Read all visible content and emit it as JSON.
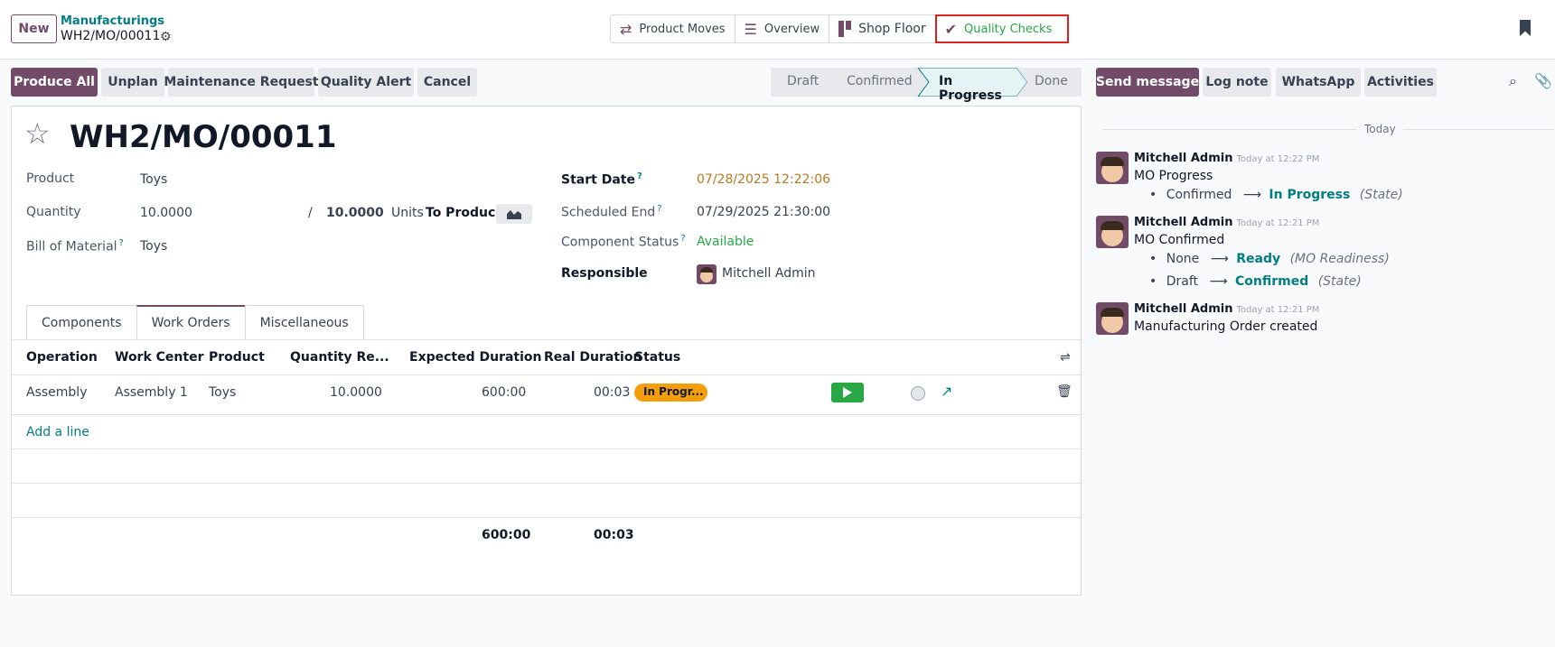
{
  "header": {
    "new_label": "New",
    "breadcrumb_parent": "Manufacturings",
    "record_name": "WH2/MO/00011"
  },
  "smart_buttons": {
    "product_moves": "Product Moves",
    "overview": "Overview",
    "shop_floor": "Shop Floor",
    "quality_checks": "Quality Checks"
  },
  "actions": {
    "produce_all": "Produce All",
    "unplan": "Unplan",
    "maintenance_request": "Maintenance Request",
    "quality_alert": "Quality Alert",
    "cancel": "Cancel"
  },
  "stages": [
    "Draft",
    "Confirmed",
    "In Progress",
    "Done"
  ],
  "form": {
    "title": "WH2/MO/00011",
    "product_label": "Product",
    "product_value": "Toys",
    "quantity_label": "Quantity",
    "quantity_value": "10.0000",
    "quantity_slash": "/",
    "quantity_target": "10.0000",
    "units_label": "Units",
    "to_produce_label": "To Produce",
    "bom_label": "Bill of Material",
    "bom_value": "Toys",
    "start_date_label": "Start Date",
    "start_date_value": "07/28/2025 12:22:06",
    "scheduled_end_label": "Scheduled End",
    "scheduled_end_value": "07/29/2025 21:30:00",
    "component_status_label": "Component Status",
    "component_status_value": "Available",
    "responsible_label": "Responsible",
    "responsible_value": "Mitchell Admin",
    "help_mark": "?"
  },
  "tabs": [
    "Components",
    "Work Orders",
    "Miscellaneous"
  ],
  "table": {
    "columns": [
      "Operation",
      "Work Center",
      "Product",
      "Quantity Re...",
      "Expected Duration",
      "Real Duration",
      "Status"
    ],
    "row": {
      "operation": "Assembly",
      "work_center": "Assembly 1",
      "product": "Toys",
      "quantity": "10.0000",
      "expected": "600:00",
      "real": "00:03",
      "status": "In Progr..."
    },
    "add_line": "Add a line",
    "total_expected": "600:00",
    "total_real": "00:03"
  },
  "chatter": {
    "send_message": "Send message",
    "log_note": "Log note",
    "whatsapp": "WhatsApp",
    "activities": "Activities",
    "day_label": "Today",
    "messages": [
      {
        "author": "Mitchell Admin",
        "time": "Today at 12:22 PM",
        "title": "MO Progress",
        "changes": [
          {
            "from": "Confirmed",
            "arrow": "⟶",
            "to": "In Progress",
            "field": "(State)"
          }
        ]
      },
      {
        "author": "Mitchell Admin",
        "time": "Today at 12:21 PM",
        "title": "MO Confirmed",
        "changes": [
          {
            "from": "None",
            "arrow": "⟶",
            "to": "Ready",
            "field": "(MO Readiness)"
          },
          {
            "from": "Draft",
            "arrow": "⟶",
            "to": "Confirmed",
            "field": "(State)"
          }
        ]
      },
      {
        "author": "Mitchell Admin",
        "time": "Today at 12:21 PM",
        "title": "Manufacturing Order created",
        "changes": []
      }
    ]
  },
  "colors": {
    "brand": "#714b67",
    "link": "#017e84",
    "status_orange": "#f59e0b",
    "play_green": "#28a745",
    "highlight_red": "#e02020"
  }
}
